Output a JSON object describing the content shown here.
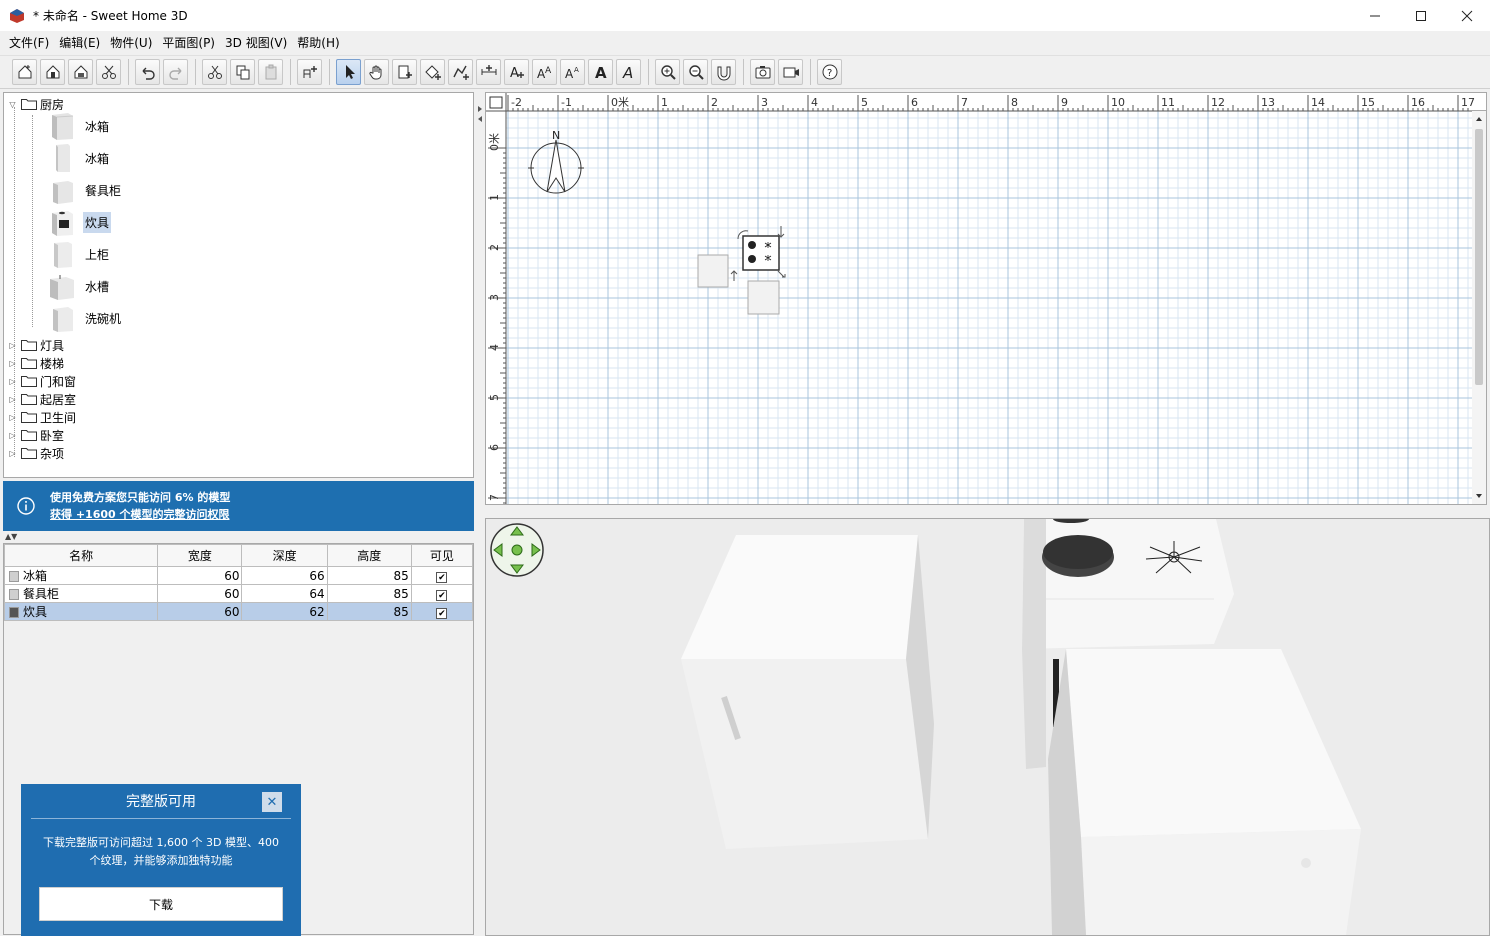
{
  "window": {
    "title": "* 未命名 - Sweet Home 3D",
    "minimize_icon": "minimize-icon",
    "maximize_icon": "maximize-icon",
    "close_icon": "close-icon"
  },
  "menu": [
    {
      "label": "文件(F)"
    },
    {
      "label": "编辑(E)"
    },
    {
      "label": "物件(U)"
    },
    {
      "label": "平面图(P)"
    },
    {
      "label": "3D 视图(V)"
    },
    {
      "label": "帮助(H)"
    }
  ],
  "toolbar": {
    "buttons": [
      {
        "icon": "new-home-icon"
      },
      {
        "icon": "open-icon"
      },
      {
        "icon": "save-icon"
      },
      {
        "icon": "cut-furniture-icon"
      },
      {
        "icon": "undo-icon"
      },
      {
        "icon": "redo-icon"
      },
      {
        "icon": "cut-icon"
      },
      {
        "icon": "copy-icon"
      },
      {
        "icon": "paste-icon"
      },
      {
        "icon": "add-furniture-icon"
      },
      {
        "icon": "select-mode-icon",
        "active": true
      },
      {
        "icon": "pan-mode-icon"
      },
      {
        "icon": "create-walls-icon"
      },
      {
        "icon": "create-rooms-icon"
      },
      {
        "icon": "create-polylines-icon"
      },
      {
        "icon": "create-dimensions-icon"
      },
      {
        "icon": "add-text-icon"
      },
      {
        "icon": "increase-text-size-icon"
      },
      {
        "icon": "decrease-text-size-icon"
      },
      {
        "icon": "bold-text-icon"
      },
      {
        "icon": "italic-text-icon"
      },
      {
        "icon": "zoom-in-icon"
      },
      {
        "icon": "zoom-out-icon"
      },
      {
        "icon": "import-icon"
      },
      {
        "icon": "create-photo-icon"
      },
      {
        "icon": "create-video-icon"
      },
      {
        "icon": "help-icon"
      }
    ]
  },
  "catalog": {
    "open_category": "厨房",
    "items": [
      {
        "label": "冰箱"
      },
      {
        "label": "冰箱"
      },
      {
        "label": "餐具柜"
      },
      {
        "label": "炊具",
        "selected": true
      },
      {
        "label": "上柜"
      },
      {
        "label": "水槽"
      },
      {
        "label": "洗碗机"
      }
    ],
    "categories": [
      "灯具",
      "楼梯",
      "门和窗",
      "起居室",
      "卫生间",
      "卧室",
      "杂项"
    ]
  },
  "info_banner": {
    "line1": "使用免费方案您只能访问 6% 的模型",
    "link": "获得 +1600 个模型的完整访问权限"
  },
  "furniture_table": {
    "columns": [
      "名称",
      "宽度",
      "深度",
      "高度",
      "可见"
    ],
    "rows": [
      {
        "name": "冰箱",
        "width": "60",
        "depth": "66",
        "height": "85",
        "visible": "✔"
      },
      {
        "name": "餐具柜",
        "width": "60",
        "depth": "64",
        "height": "85",
        "visible": "✔"
      },
      {
        "name": "炊具",
        "width": "60",
        "depth": "62",
        "height": "85",
        "visible": "✔",
        "selected": true
      }
    ]
  },
  "promo": {
    "title": "完整版可用",
    "body_line1": "下载完整版可访问超过 1,600 个 3D 模型、400",
    "body_line2": "个纹理，并能够添加独特功能",
    "button": "下载",
    "close": "✕"
  },
  "plan": {
    "ruler_x_labels": [
      "-2",
      "-1",
      "0米",
      "1",
      "2",
      "3",
      "4",
      "5",
      "6",
      "7",
      "8",
      "9",
      "10",
      "11",
      "12",
      "13",
      "14",
      "15",
      "16",
      "17"
    ],
    "ruler_y_labels": [
      "0米",
      "1",
      "2",
      "3",
      "4",
      "5",
      "6",
      "7"
    ],
    "compass_label": "N"
  },
  "colors": {
    "accent": "#1e6fb0",
    "grid_minor": "#d8e6f2",
    "grid_major": "#a9c4dc",
    "selection": "#c9d9ee"
  }
}
